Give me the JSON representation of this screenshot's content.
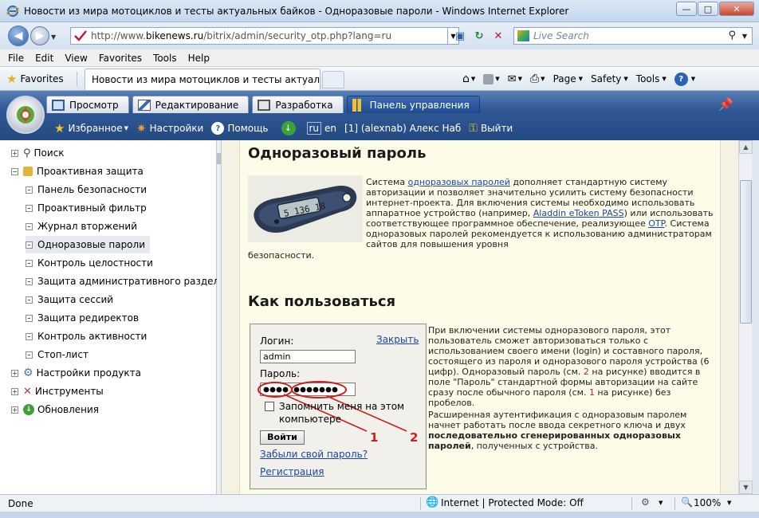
{
  "window": {
    "title": "Новости из мира мотоциклов и тесты актуальных байков - Одноразовые пароли - Windows Internet Explorer",
    "url_prefix": "http://www.",
    "url_host": "bikenews.ru",
    "url_path": "/bitrix/admin/security_otp.php?lang=ru",
    "search_placeholder": "Live Search"
  },
  "menu": [
    "File",
    "Edit",
    "View",
    "Favorites",
    "Tools",
    "Help"
  ],
  "favbar": {
    "favorites_label": "Favorites",
    "tab_title": "Новости из мира мотоциклов и тесты актуаль...",
    "page_label": "Page",
    "safety_label": "Safety",
    "tools_label": "Tools"
  },
  "bitrix": {
    "tabs": [
      "Просмотр",
      "Редактирование",
      "Разработка",
      "Панель управления"
    ],
    "toolbar": {
      "favorites": "Избранное",
      "settings": "Настройки",
      "help": "Помощь",
      "lang_ru": "ru",
      "lang_en": "en",
      "user": "[1] (alexnab) Алекс Наб",
      "logout": "Выйти"
    }
  },
  "tree": {
    "items": [
      {
        "label": "Поиск",
        "level": 0
      },
      {
        "label": "Проактивная защита",
        "level": 0
      },
      {
        "label": "Панель безопасности",
        "level": 1
      },
      {
        "label": "Проактивный фильтр",
        "level": 1
      },
      {
        "label": "Журнал вторжений",
        "level": 1
      },
      {
        "label": "Одноразовые пароли",
        "level": 1
      },
      {
        "label": "Контроль целостности",
        "level": 1
      },
      {
        "label": "Защита административного раздела",
        "level": 1
      },
      {
        "label": "Защита сессий",
        "level": 1
      },
      {
        "label": "Защита редиректов",
        "level": 1
      },
      {
        "label": "Контроль активности",
        "level": 1
      },
      {
        "label": "Стоп-лист",
        "level": 1
      },
      {
        "label": "Настройки продукта",
        "level": 0
      },
      {
        "label": "Инструменты",
        "level": 0
      },
      {
        "label": "Обновления",
        "level": 0
      }
    ]
  },
  "content": {
    "heading1": "Одноразовый пароль",
    "device_display": "5 136 18",
    "p1_a": "Система ",
    "p1_link1": "одноразовых паролей",
    "p1_b": " дополняет стандартную систему авторизации и позволяет значительно усилить систему безопасности интернет-проекта. Для включения системы необходимо использовать аппаратное устройство (например, ",
    "p1_link2": "Aladdin eToken PASS",
    "p1_c": ") или использовать соответствующее программное обеспечение, реализующее ",
    "p1_link3": "OTP",
    "p1_d": ". Система одноразовых паролей рекомендуется к использованию администраторам сайтов для повышения уровня",
    "p1_e": "безопасности.",
    "heading2": "Как пользоваться",
    "login": {
      "login_label": "Логин:",
      "login_value": "admin",
      "close_link": "Закрыть",
      "password_label": "Пароль:",
      "remember_label": "Запомнить меня на этом компьютере",
      "submit_label": "Войти",
      "forgot_link": "Забыли свой пароль?",
      "register_link": "Регистрация",
      "marker1": "1",
      "marker2": "2"
    },
    "p2_a": "При включении системы одноразового пароля, этот пользователь сможет авторизоваться только с использованием своего имени (login) и составного пароля, состоящего из пароля и одноразового пароля устройства (6 цифр). Одноразовый пароль (см. ",
    "p2_n2": "2",
    "p2_b": " на рисунке) вводится в поле \"Пароль\" стандартной формы авторизации на сайте сразу после обычного пароля (см. ",
    "p2_n1": "1",
    "p2_c": " на рисунке) без пробелов.",
    "p3_a": "Расширенная аутентификация с одноразовым паролем начнет работать после ввода секретного ключа и двух ",
    "p3_bold": "последовательно сгенерированных одноразовых паролей",
    "p3_b": ", полученных с устройства."
  },
  "status": {
    "text": "Done",
    "zone": "Internet | Protected Mode: Off",
    "zoom": "100%"
  },
  "colors": {
    "panel_blue": "#2f5794",
    "link": "#1a47a6",
    "annotation_red": "#cc1f1f",
    "content_bg": "#fdfce8"
  }
}
